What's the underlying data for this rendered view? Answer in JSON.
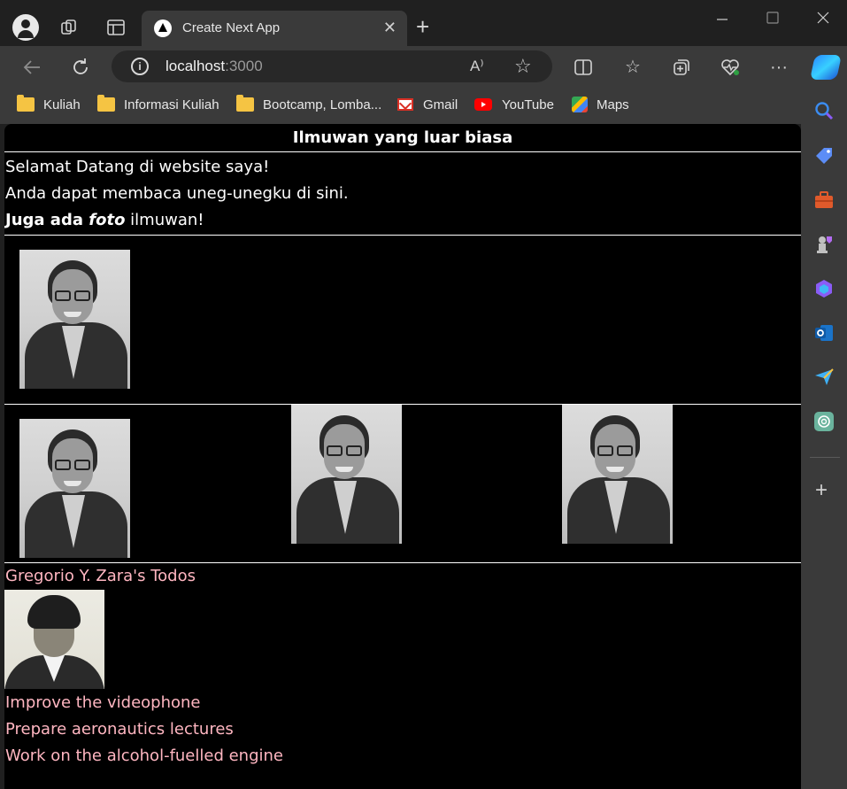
{
  "browser": {
    "tab_title": "Create Next App",
    "url_host": "localhost",
    "url_port": ":3000",
    "new_tab_symbol": "+",
    "tab_close_symbol": "✕",
    "bookmarks": [
      {
        "label": "Kuliah",
        "icon": "folder-icon"
      },
      {
        "label": "Informasi Kuliah",
        "icon": "folder-icon"
      },
      {
        "label": "Bootcamp, Lomba...",
        "icon": "folder-icon"
      },
      {
        "label": "Gmail",
        "icon": "gmail-icon"
      },
      {
        "label": "YouTube",
        "icon": "youtube-icon"
      },
      {
        "label": "Maps",
        "icon": "maps-icon"
      }
    ],
    "read_aloud_symbol": "A⁾",
    "accent_color": "#ffb6c1"
  },
  "page": {
    "title": "Ilmuwan yang luar biasa",
    "intro_line_1": "Selamat Datang di website saya!",
    "intro_line_2": "Anda dapat membaca uneg-unegku di sini.",
    "intro_line_3_bold": "Juga ada ",
    "intro_line_3_italic": "foto",
    "intro_line_3_rest": " ilmuwan!",
    "todos_heading": "Gregorio Y. Zara's Todos",
    "todos": [
      "Improve the videophone",
      "Prepare aeronautics lectures",
      "Work on the alcohol-fuelled engine"
    ]
  }
}
